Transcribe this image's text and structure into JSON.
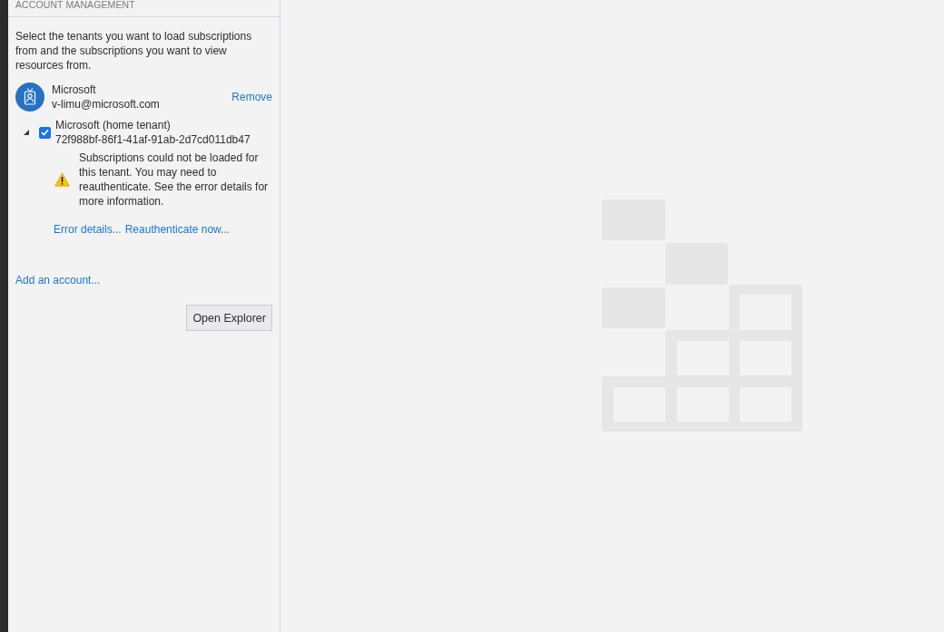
{
  "header": {
    "title": "ACCOUNT MANAGEMENT"
  },
  "description": "Select the tenants you want to load subscriptions from and the subscriptions you want to view resources from.",
  "accounts": [
    {
      "name": "Microsoft",
      "email": "v-limu@microsoft.com",
      "remove_link": "Remove",
      "tenants": [
        {
          "name": "Microsoft (home tenant)",
          "id": "72f988bf-86f1-41af-91ab-2d7cd011db47",
          "expanded": true,
          "checked": true,
          "warning": {
            "message": "Subscriptions could not be loaded for this tenant. You may need to reauthenticate. See the error details for more information.",
            "links": [
              "Error details...",
              "Reauthenticate now..."
            ]
          }
        }
      ]
    }
  ],
  "add_account_link": "Add an account...",
  "open_button": "Open Explorer"
}
